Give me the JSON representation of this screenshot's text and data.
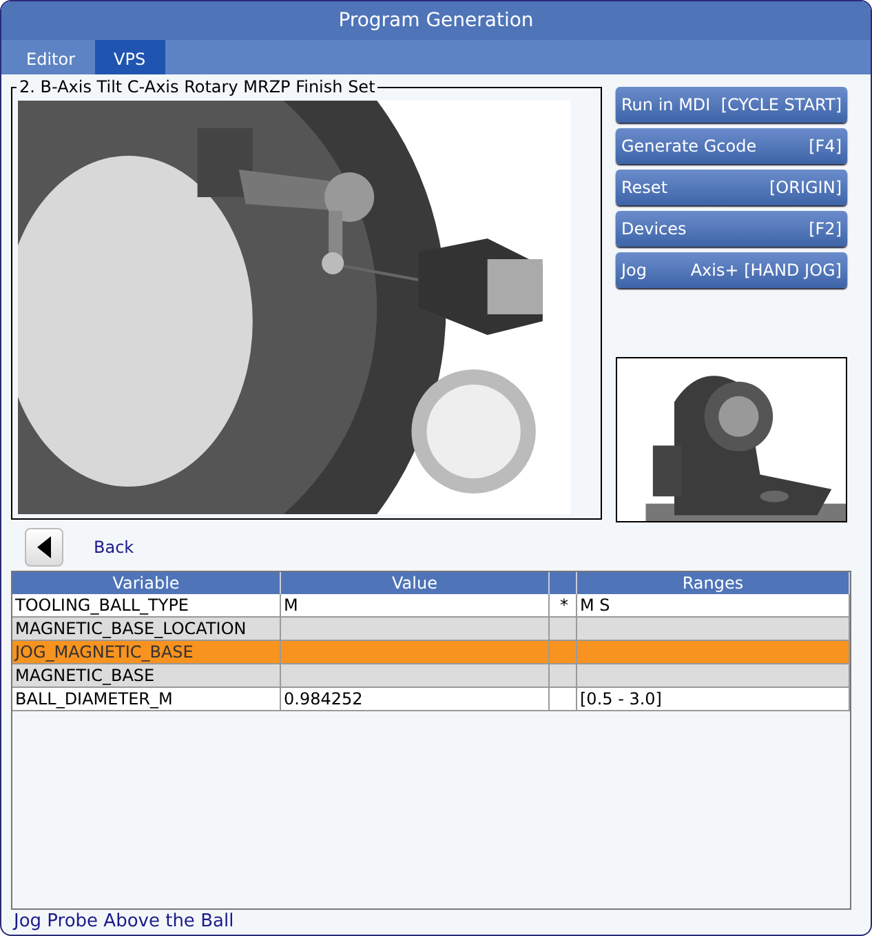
{
  "window": {
    "title": "Program Generation"
  },
  "tabs": [
    {
      "label": "Editor",
      "selected": false
    },
    {
      "label": "VPS",
      "selected": true
    }
  ],
  "group": {
    "title": "2. B-Axis Tilt C-Axis Rotary MRZP Finish Set"
  },
  "buttons": [
    {
      "label": "Run in MDI",
      "key": "[CYCLE START]"
    },
    {
      "label": "Generate Gcode",
      "key": "[F4]"
    },
    {
      "label": "Reset",
      "key": "[ORIGIN]"
    },
    {
      "label": "Devices",
      "key": "[F2]"
    },
    {
      "label": "Jog",
      "key": "Axis+ [HAND JOG]"
    }
  ],
  "back": {
    "label": "Back"
  },
  "table": {
    "columns": [
      "Variable",
      "Value",
      "",
      "Ranges"
    ],
    "rows": [
      {
        "cells": [
          "TOOLING_BALL_TYPE",
          "M",
          "*",
          "M S"
        ],
        "selected": false,
        "disabled": false
      },
      {
        "cells": [
          "MAGNETIC_BASE_LOCATION",
          "",
          "",
          ""
        ],
        "selected": false,
        "disabled": true
      },
      {
        "cells": [
          "JOG_MAGNETIC_BASE",
          "",
          "",
          ""
        ],
        "selected": true,
        "disabled": false
      },
      {
        "cells": [
          "MAGNETIC_BASE",
          "",
          "",
          ""
        ],
        "selected": false,
        "disabled": true
      },
      {
        "cells": [
          "BALL_DIAMETER_M",
          "0.984252",
          "",
          "[0.5 - 3.0]"
        ],
        "selected": false,
        "disabled": false
      }
    ]
  },
  "status": "Jog Probe Above the Ball"
}
